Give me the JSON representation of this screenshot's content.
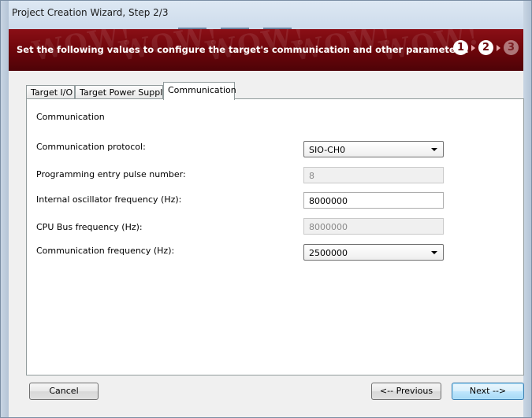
{
  "window": {
    "title": "Project Creation Wizard, Step 2/3"
  },
  "banner": {
    "message": "Set the following values to configure the target's communication and other parameters.",
    "watermark": "WOW!",
    "steps": [
      "1",
      "2",
      "3"
    ],
    "current_step": 2,
    "color": "#6a050a"
  },
  "tabs": [
    {
      "label": "Target I/O"
    },
    {
      "label": "Target Power Supply"
    },
    {
      "label": "Communication",
      "active": true
    }
  ],
  "section": {
    "label": "Communication"
  },
  "fields": {
    "protocol": {
      "label": "Communication protocol:",
      "value": "SIO-CH0"
    },
    "pulse": {
      "label": "Programming entry pulse number:",
      "value": "8"
    },
    "osc": {
      "label": "Internal oscillator frequency (Hz):",
      "value": "8000000"
    },
    "cpubus": {
      "label": "CPU Bus frequency (Hz):",
      "value": "8000000"
    },
    "commfreq": {
      "label": "Communication frequency (Hz):",
      "value": "2500000"
    }
  },
  "buttons": {
    "cancel": "Cancel",
    "previous": "<-- Previous",
    "next": "Next -->"
  },
  "icons": {
    "caret": "chevron-down-icon"
  }
}
